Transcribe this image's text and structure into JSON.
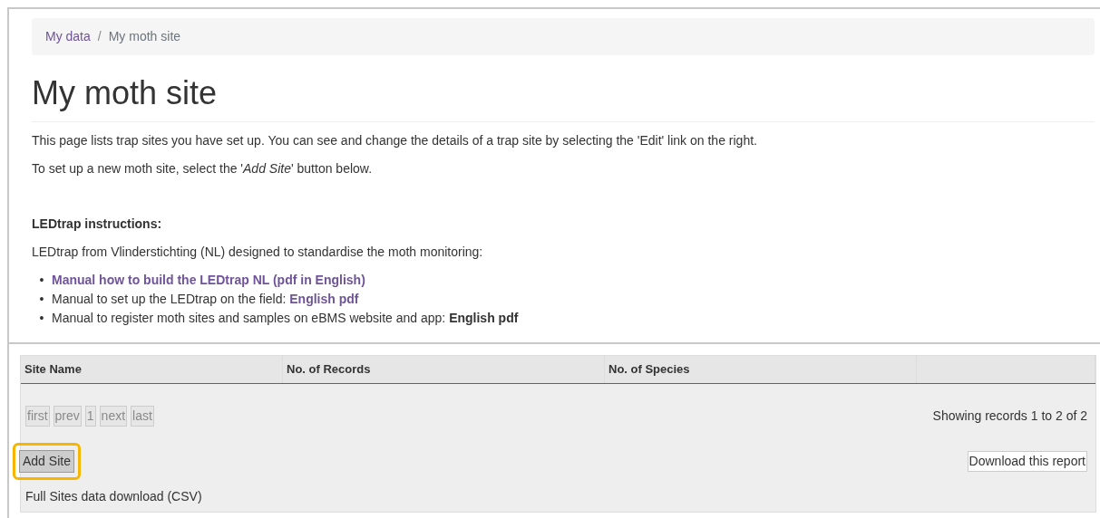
{
  "breadcrumb": [
    {
      "label": "My data",
      "kind": "link"
    },
    {
      "label": "My moth site",
      "kind": "current"
    }
  ],
  "breadcrumb_separator": "/",
  "title": "My moth site",
  "intro": [
    "This page lists trap sites you have set up. You can see and change the details of a trap site by selecting the 'Edit' link on the right.",
    "To set up a new moth site, select the '*Add Site*' button below."
  ],
  "instructions": {
    "heading": "LEDtrap instructions:",
    "text": "LEDtrap from Vlinderstichting (NL) designed to standardise the moth monitoring:",
    "items": [
      {
        "marker": "•",
        "link": "Manual how to build the LEDtrap NL (pdf in English)",
        "kind": "link"
      },
      {
        "marker": "•",
        "text": "Manual to set up the LEDtrap on the field: ",
        "link": "English pdf",
        "kind": "link"
      },
      {
        "marker": "•",
        "text": "Manual to register moth sites and samples on eBMS website and app: ",
        "link": "English pdf",
        "kind": "bold"
      }
    ]
  },
  "table": {
    "columns": [
      "Site Name",
      "No. of Records",
      "No. of Species"
    ],
    "pager": [
      {
        "label": "first",
        "disabled": true
      },
      {
        "label": "prev",
        "disabled": true
      },
      {
        "label": "1",
        "disabled": true
      },
      {
        "label": "next",
        "disabled": true
      },
      {
        "label": "last",
        "disabled": true
      }
    ],
    "summary": "Showing records 1 to 2 of 2",
    "add_button": {
      "label": "Add Site",
      "highlighted": true
    },
    "download_button": "Download this report",
    "csv_link": "Full Sites data download (CSV)"
  }
}
